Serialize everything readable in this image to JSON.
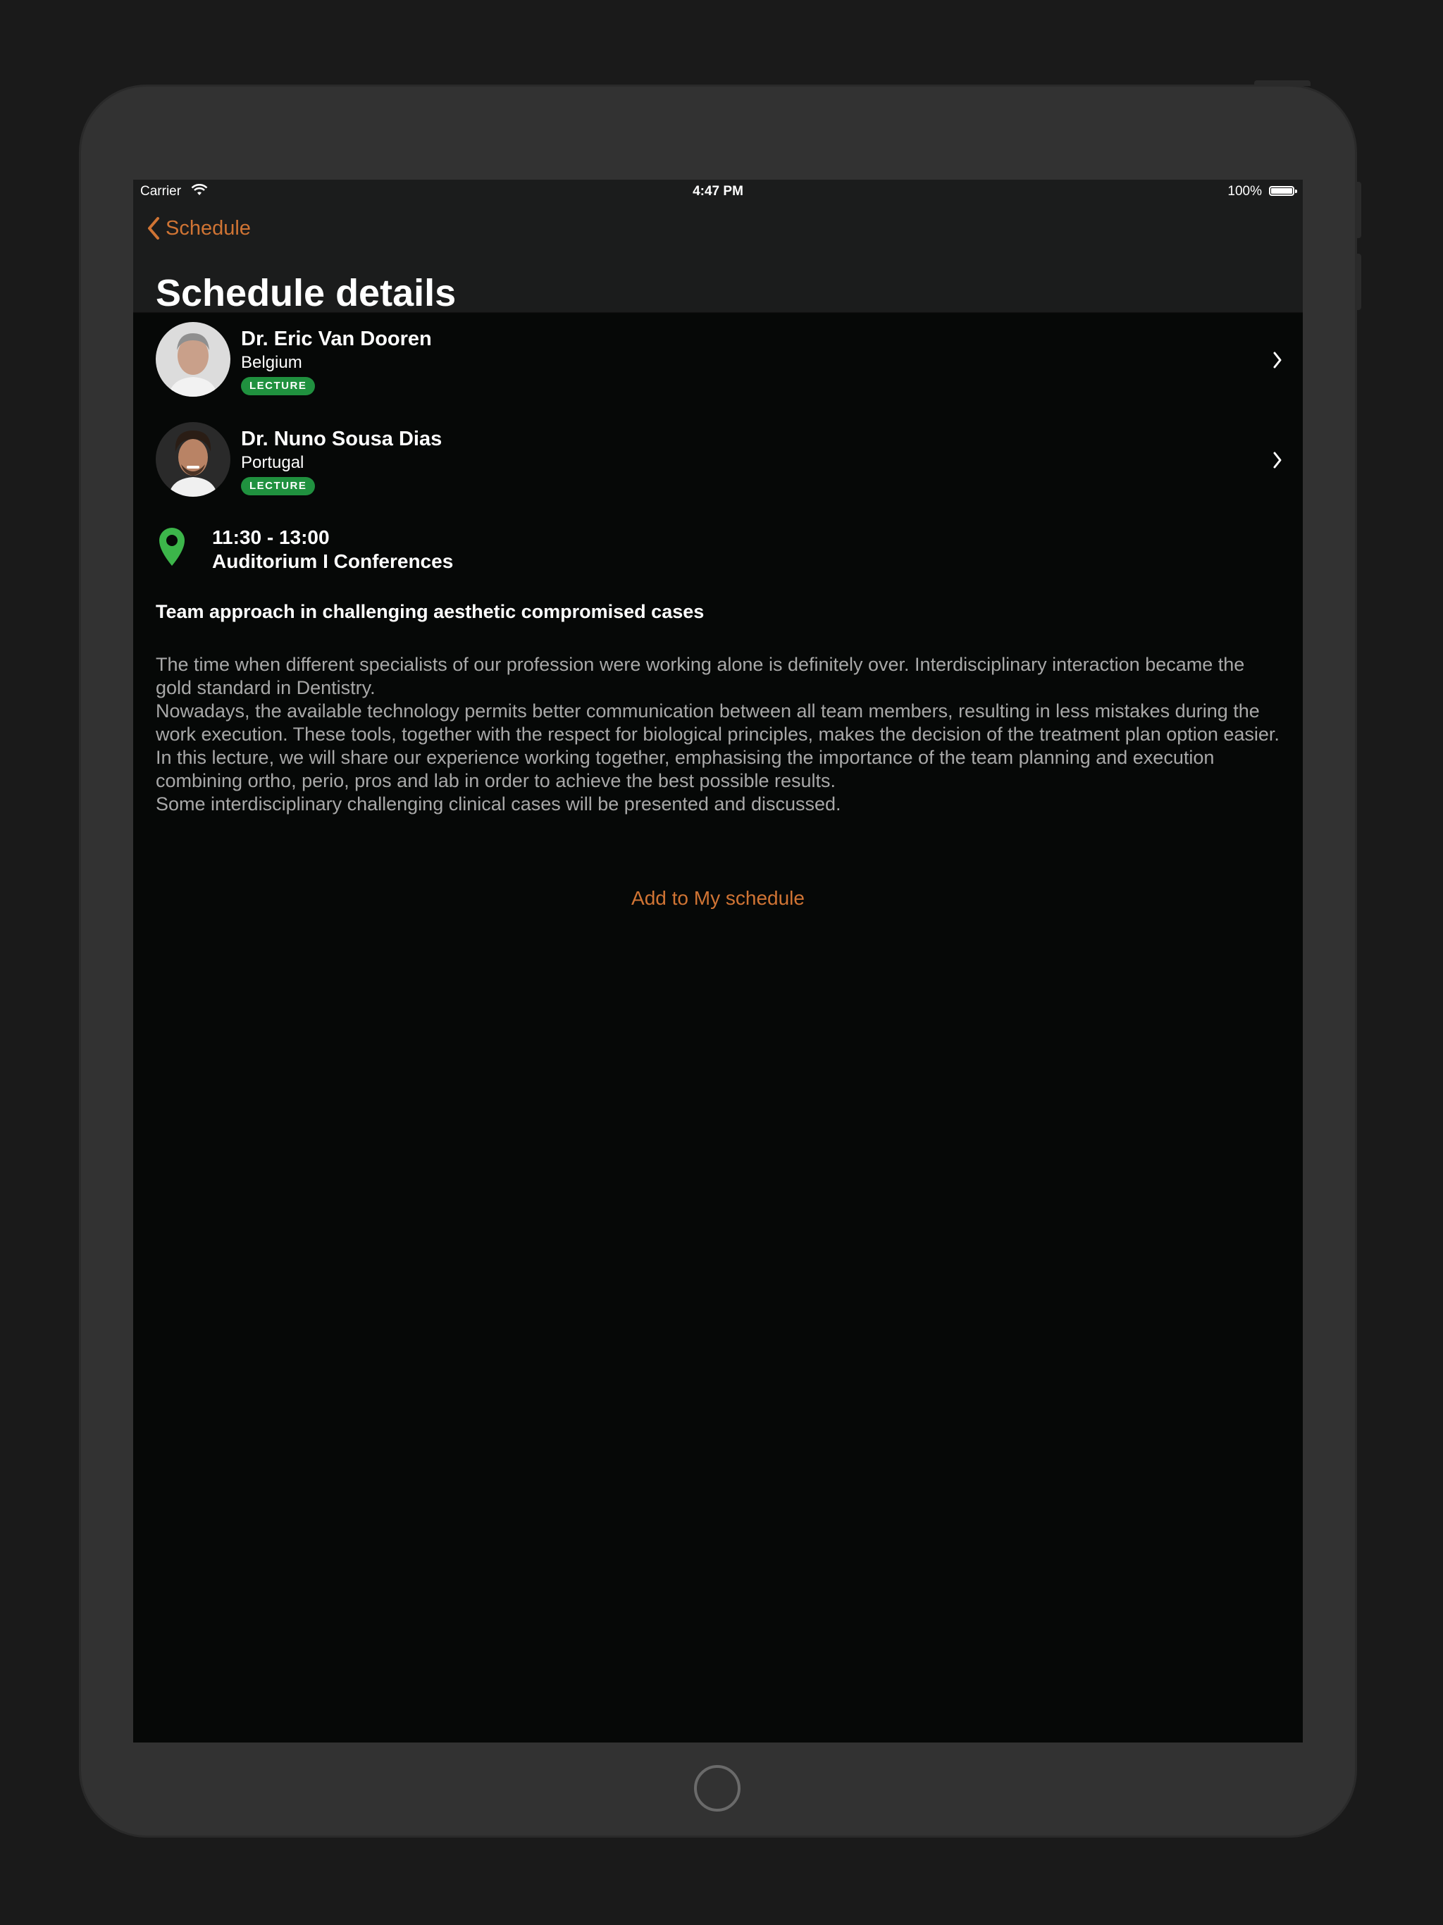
{
  "status_bar": {
    "carrier": "Carrier",
    "time": "4:47 PM",
    "battery": "100%"
  },
  "nav": {
    "back_label": "Schedule",
    "title": "Schedule details"
  },
  "speakers": [
    {
      "name": "Dr. Eric Van Dooren",
      "country": "Belgium",
      "badge": "LECTURE"
    },
    {
      "name": "Dr. Nuno Sousa Dias",
      "country": "Portugal",
      "badge": "LECTURE"
    }
  ],
  "location": {
    "time": "11:30 - 13:00",
    "room": "Auditorium I Conferences"
  },
  "session": {
    "title": "Team approach in challenging aesthetic compromised cases",
    "description": "The time when different specialists of our profession were working alone is definitely over. Interdisciplinary interaction became the gold standard in Dentistry.\nNowadays, the available technology permits better communication between all team members, resulting in less mistakes during the work execution. These tools, together with the respect for biological principles, makes the decision of the treatment plan option easier.\nIn this lecture, we will share our experience working together, emphasising the importance of the team planning and execution combining ortho, perio, pros and lab in order to achieve the best possible results.\nSome interdisciplinary challenging clinical cases will be presented and discussed."
  },
  "actions": {
    "add_label": "Add to My schedule"
  },
  "colors": {
    "accent": "#d07434",
    "badge": "#20913f",
    "pin": "#3cb54a",
    "background": "#060807",
    "nav_background": "#1b1c1c"
  },
  "icons": {
    "back": "chevron-left-icon",
    "row_disclosure": "chevron-right-icon",
    "location": "map-pin-icon",
    "wifi": "wifi-icon",
    "battery": "battery-icon"
  }
}
